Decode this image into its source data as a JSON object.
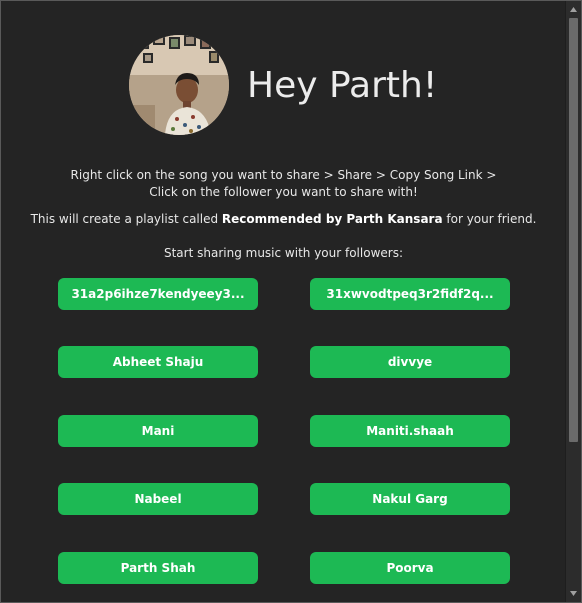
{
  "greeting": "Hey Parth!",
  "instructions": {
    "line1": "Right click on the song you want to share > Share > Copy Song Link >",
    "line2": "Click on the follower you want to share with!"
  },
  "note": {
    "prefix": "This will create a playlist called ",
    "playlist_name": "Recommended by Parth Kansara",
    "suffix": " for your friend."
  },
  "subhead": "Start sharing music with your followers:",
  "followers": [
    "31a2p6ihze7kendyeey3...",
    "31xwvodtpeq3r2fidf2q...",
    "Abheet Shaju",
    "divvye",
    "Mani",
    "Maniti.shaah",
    "Nabeel",
    "Nakul Garg",
    "Parth Shah",
    "Poorva"
  ],
  "colors": {
    "background": "#242424",
    "button": "#1db954",
    "text": "#ffffff"
  },
  "icons": {
    "avatar": "profile-photo",
    "scroll_up": "triangle-up-icon",
    "scroll_down": "triangle-down-icon"
  }
}
